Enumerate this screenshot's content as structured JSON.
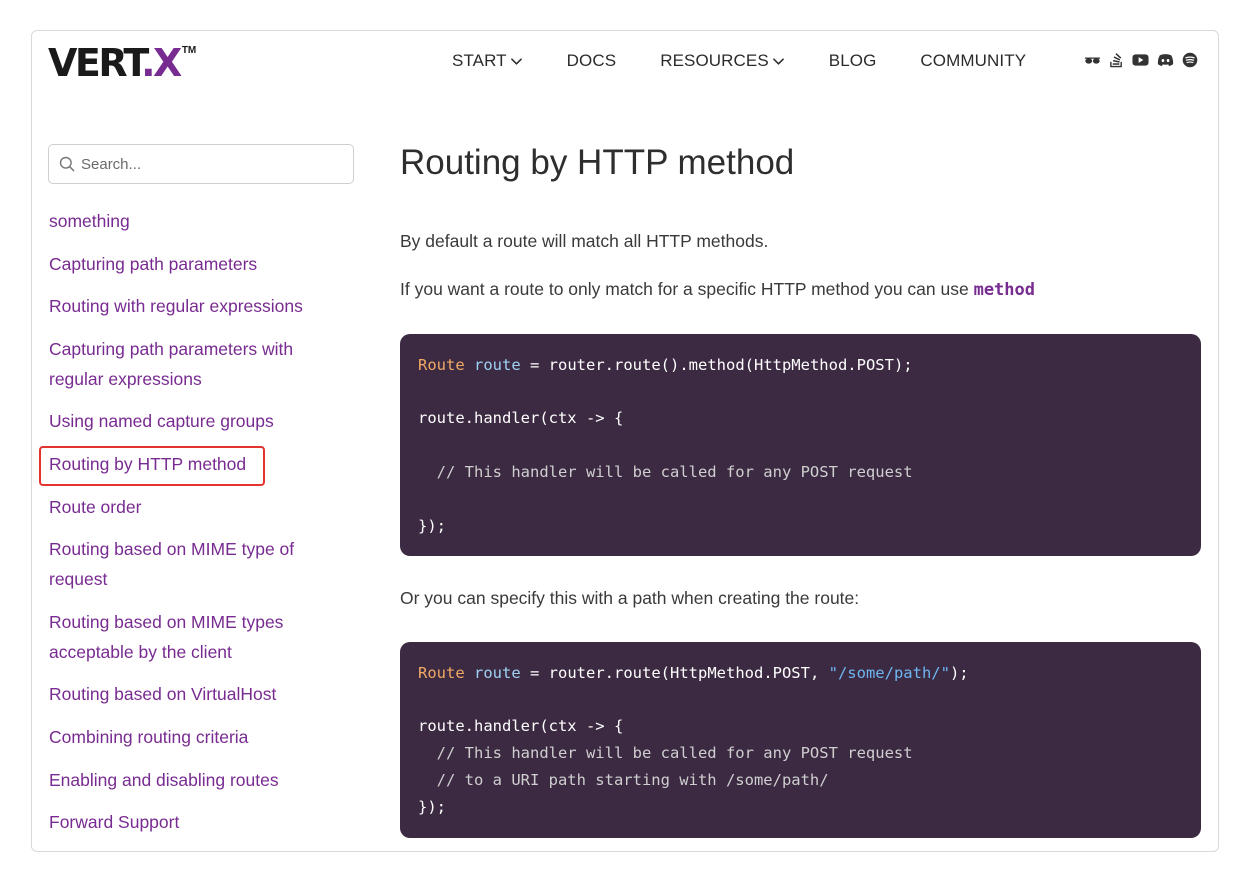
{
  "header": {
    "logo_main": "VERT",
    "logo_dot": ".",
    "logo_x": "X",
    "logo_tm": "TM",
    "nav": [
      {
        "label": "START",
        "has_dropdown": true
      },
      {
        "label": "DOCS",
        "has_dropdown": false
      },
      {
        "label": "RESOURCES",
        "has_dropdown": true
      },
      {
        "label": "BLOG",
        "has_dropdown": false
      },
      {
        "label": "COMMUNITY",
        "has_dropdown": false
      }
    ],
    "social_icons": [
      "sunglasses-icon",
      "stack-overflow-icon",
      "youtube-icon",
      "discord-icon",
      "community-icon"
    ]
  },
  "sidebar": {
    "search_placeholder": "Search...",
    "items": [
      {
        "label": "something"
      },
      {
        "label": "Capturing path parameters"
      },
      {
        "label": "Routing with regular expressions"
      },
      {
        "label": "Capturing path parameters with regular expressions"
      },
      {
        "label": "Using named capture groups"
      },
      {
        "label": "Routing by HTTP method",
        "active": true
      },
      {
        "label": "Route order"
      },
      {
        "label": "Routing based on MIME type of request"
      },
      {
        "label": "Routing based on MIME types acceptable by the client"
      },
      {
        "label": "Routing based on VirtualHost"
      },
      {
        "label": "Combining routing criteria"
      },
      {
        "label": "Enabling and disabling routes"
      },
      {
        "label": "Forward Support"
      }
    ]
  },
  "main": {
    "title": "Routing by HTTP method",
    "para1": "By default a route will match all HTTP methods.",
    "para2_text": "If you want a route to only match for a specific HTTP method you can use ",
    "para2_code": "method",
    "code1": {
      "line1_kw": "Route",
      "line1_var": "route",
      "line1_rest": " = router.route().method(HttpMethod.POST);",
      "line2": "route.handler(ctx -> {",
      "line3": "  // This handler will be called for any POST request",
      "line4": "});"
    },
    "para3": "Or you can specify this with a path when creating the route:",
    "code2": {
      "line1_kw": "Route",
      "line1_var": "route",
      "line1_mid": " = router.route(HttpMethod.POST, ",
      "line1_str": "\"/some/path/\"",
      "line1_end": ");",
      "line2": "route.handler(ctx -> {",
      "line3": "  // This handler will be called for any POST request",
      "line4": "  // to a URI path starting with /some/path/",
      "line5": "});"
    }
  },
  "colors": {
    "brand_purple": "#782b90",
    "code_bg": "#3b2a42",
    "highlight_border": "#e3342f"
  }
}
